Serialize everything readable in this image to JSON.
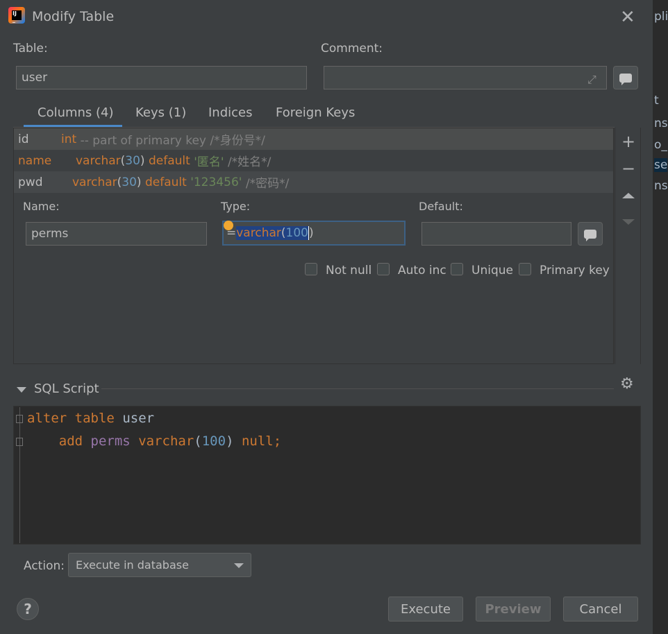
{
  "window": {
    "title": "Modify Table"
  },
  "table": {
    "label": "Table:",
    "value": "user"
  },
  "comment": {
    "label": "Comment:",
    "value": ""
  },
  "tabs": [
    {
      "label": "Columns (4)",
      "active": true
    },
    {
      "label": "Keys (1)"
    },
    {
      "label": "Indices"
    },
    {
      "label": "Foreign Keys"
    }
  ],
  "columns": [
    {
      "name": "id",
      "type": "int",
      "rest": " -- part of primary key /*身份号*/"
    },
    {
      "name": "name",
      "type": "varchar",
      "size": "30",
      "default_kw": "default",
      "default_val": "'匿名'",
      "comment": "/*姓名*/"
    },
    {
      "name": "pwd",
      "type": "varchar",
      "size": "30",
      "default_kw": "default",
      "default_val": "'123456'",
      "comment": "/*密码*/"
    }
  ],
  "editor": {
    "name_label": "Name:",
    "name_value": "perms",
    "type_label": "Type:",
    "type_prefix": "=",
    "type_word": "varchar",
    "type_open": "(",
    "type_num": "100",
    "type_close": ")",
    "default_label": "Default:",
    "default_value": ""
  },
  "checkboxes": [
    {
      "label": "Not null",
      "checked": false
    },
    {
      "label": "Auto inc",
      "checked": false
    },
    {
      "label": "Unique",
      "checked": false
    },
    {
      "label": "Primary key",
      "checked": false
    }
  ],
  "sql": {
    "section_label": "SQL Script",
    "line1_kw1": "alter",
    "line1_kw2": "table",
    "line1_name": "user",
    "line2_kw": "add",
    "line2_col": "perms",
    "line2_type": "varchar",
    "line2_num": "100",
    "line2_null": "null;"
  },
  "action": {
    "label": "Action:",
    "value": "Execute in database"
  },
  "buttons": {
    "execute": "Execute",
    "preview": "Preview",
    "cancel": "Cancel",
    "help": "?"
  },
  "background_fragments": [
    "pli",
    "t",
    "ns",
    "o_r",
    "se",
    "ns"
  ],
  "colors": {
    "keyword": "#cc7832",
    "number": "#6897bb",
    "string": "#6a8759",
    "comment": "#808080",
    "accent": "#4a88c7",
    "selection": "#214283"
  }
}
